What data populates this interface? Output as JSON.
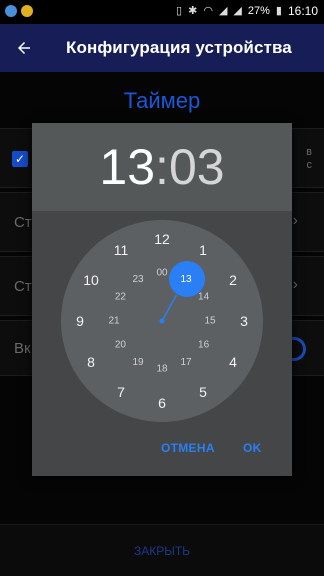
{
  "status_bar": {
    "battery": "27%",
    "time": "16:10"
  },
  "app_bar": {
    "back_icon": "arrow-left-icon",
    "title": "Конфигурация устройства"
  },
  "background": {
    "section_title": "Таймер",
    "card1_side_text_line1": "в",
    "card1_side_text_line2": "с",
    "card2_text": "Ст",
    "card3_text": "Ст",
    "card4_text": "Вк",
    "bottom_button": "ЗАКРЫТЬ"
  },
  "dialog": {
    "hour": "13",
    "colon": ":",
    "minute": "03",
    "cancel_label": "ОТМЕНА",
    "ok_label": "OK",
    "selected_hour": "13",
    "outer_hours": [
      "12",
      "1",
      "2",
      "3",
      "4",
      "5",
      "6",
      "7",
      "8",
      "9",
      "10",
      "11"
    ],
    "inner_hours": [
      "00",
      "13",
      "14",
      "15",
      "16",
      "17",
      "18",
      "19",
      "20",
      "21",
      "22",
      "23"
    ]
  },
  "colors": {
    "accent": "#2a7ff5",
    "appbar": "#161d57",
    "dialog_bg": "#444648",
    "dialog_header": "#555859",
    "clock_face": "#5d6062"
  }
}
